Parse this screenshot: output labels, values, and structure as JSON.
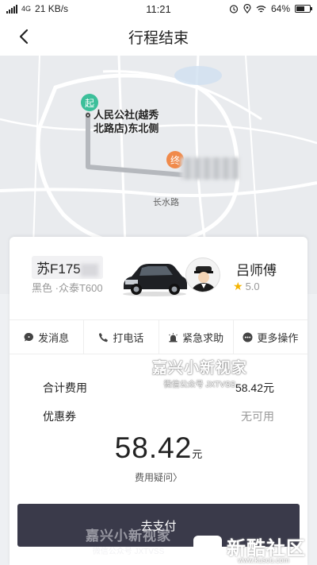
{
  "status_bar": {
    "network": "4G",
    "speed": "21 KB/s",
    "time": "11:21",
    "battery": "64%",
    "battery_level": 0.64
  },
  "header": {
    "title": "行程结束"
  },
  "map": {
    "start_badge": "起",
    "end_badge": "终",
    "start_place_line1": "人民公社(越秀",
    "start_place_line2": "北路店)东北侧",
    "road_label": "长水路"
  },
  "driver": {
    "plate": "苏F175",
    "car": "黑色 ·众泰T600",
    "name": "吕师傅",
    "rating": "5.0"
  },
  "actions": [
    {
      "label": "发消息",
      "icon": "message-icon"
    },
    {
      "label": "打电话",
      "icon": "phone-icon"
    },
    {
      "label": "紧急求助",
      "icon": "alarm-icon"
    },
    {
      "label": "更多操作",
      "icon": "more-icon"
    }
  ],
  "fees": {
    "total_label": "合计费用",
    "total_value": "58.42元",
    "coupon_label": "优惠券",
    "coupon_value": "无可用",
    "amount": "58.42",
    "unit": "元",
    "question": "费用疑问〉"
  },
  "pay_button": "去支付",
  "watermark": {
    "line1": "嘉兴小新视家",
    "line2": "微信公众号 JXTVSS",
    "bottom_line1": "嘉兴小新视家",
    "bottom_line2": "微信公众号 JXTVSS"
  },
  "brand": {
    "text": "新酷社区",
    "url": "www.kusou.com"
  },
  "colors": {
    "start_pin": "#3cbf9a",
    "end_pin": "#f08a4b",
    "pay_button": "#3a3a4a",
    "star": "#f5b400"
  }
}
